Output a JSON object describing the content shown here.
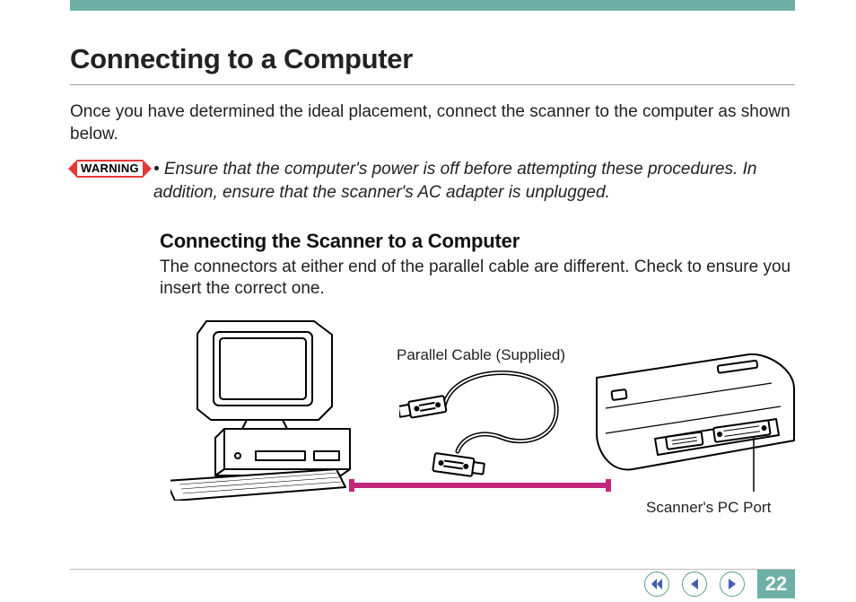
{
  "page": {
    "title": "Connecting to a Computer",
    "intro": "Once you have determined the ideal placement, connect the scanner to the computer as shown below.",
    "warning_label": "WARNING",
    "warning_text": "• Ensure that the computer's power is off before attempting these procedures. In addition, ensure that the scanner's AC adapter is unplugged.",
    "subsection": {
      "heading": "Connecting the Scanner to a Computer",
      "body": "The connectors at either end of the parallel cable are different. Check to ensure you insert the correct one."
    },
    "labels": {
      "cable": "Parallel Cable (Supplied)",
      "port": "Scanner's PC Port"
    }
  },
  "footer": {
    "page_number": "22"
  },
  "colors": {
    "accent": "#6fb0a6",
    "warning": "#e53935",
    "magenta": "#c1277a"
  }
}
